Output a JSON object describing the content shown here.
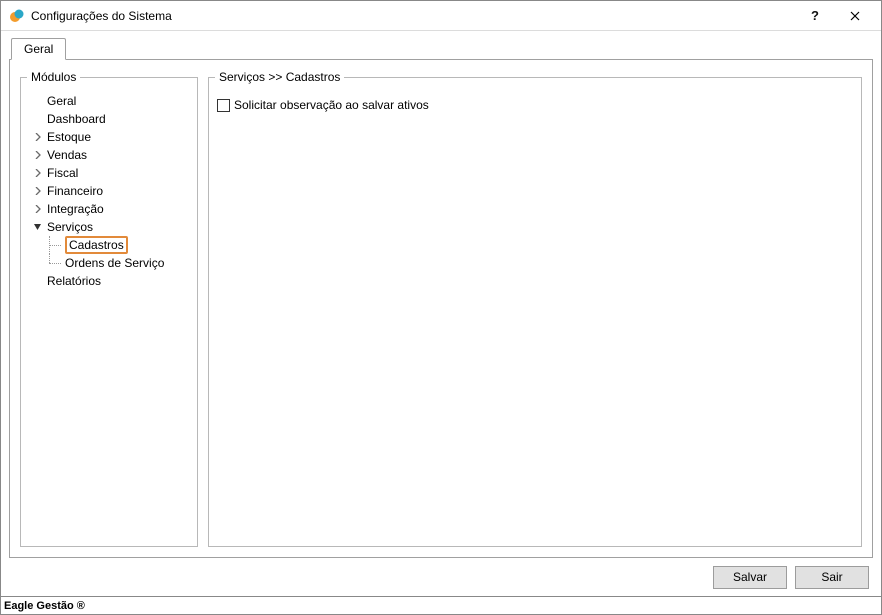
{
  "window": {
    "title": "Configurações do Sistema"
  },
  "tabs": {
    "geral": "Geral"
  },
  "modulos": {
    "legend": "Módulos",
    "items": {
      "geral": "Geral",
      "dashboard": "Dashboard",
      "estoque": "Estoque",
      "vendas": "Vendas",
      "fiscal": "Fiscal",
      "financeiro": "Financeiro",
      "integracao": "Integração",
      "servicos": "Serviços",
      "servicos_cadastros": "Cadastros",
      "servicos_ordens": "Ordens de Serviço",
      "relatorios": "Relatórios"
    }
  },
  "content": {
    "breadcrumb": "Serviços >> Cadastros",
    "checkbox_label": "Solicitar observação ao salvar ativos"
  },
  "buttons": {
    "save": "Salvar",
    "exit": "Sair"
  },
  "statusbar": {
    "text": "Eagle Gestão ®"
  }
}
